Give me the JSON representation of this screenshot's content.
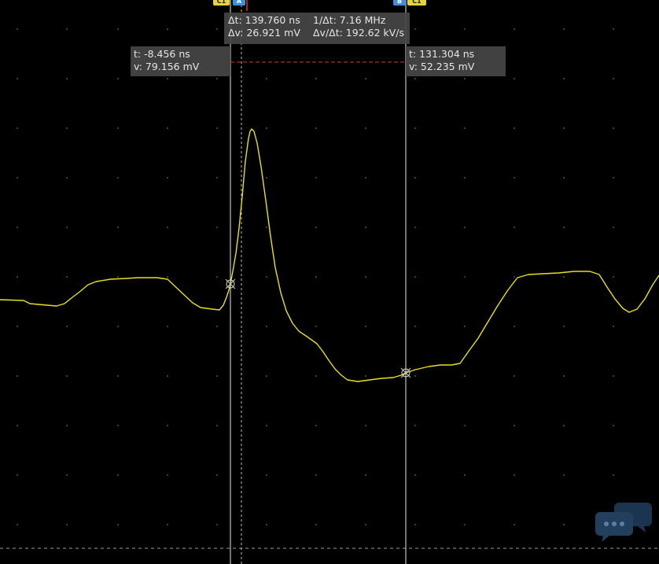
{
  "colors": {
    "background": "#000000",
    "waveform": "#e8e020",
    "grid_dots": "#6a6a6a",
    "cursor_line": "#e8e8e8",
    "delta_marker": "#d23a1f",
    "readout_bg": "#464646",
    "readout_text": "#e6e6e6",
    "channel_badge": "#e5d441",
    "source_badge": "#3d8fe0"
  },
  "delta_readout": {
    "dt": "Δt: 139.760 ns",
    "dv": "Δv: 26.921 mV",
    "inv_dt": "1/Δt: 7.16 MHz",
    "dv_dt": "Δv/Δt: 192.62 kV/s"
  },
  "cursor1": {
    "t": "t: -8.456 ns",
    "v": "v: 79.156 mV",
    "channel_badge": "C1",
    "source_badge": "A"
  },
  "cursor2": {
    "t": "t: 131.304 ns",
    "v": "v: 52.235 mV",
    "channel_badge": "C1",
    "source_badge": "B"
  },
  "icons": {
    "chat": "chat-bubbles-icon"
  }
}
